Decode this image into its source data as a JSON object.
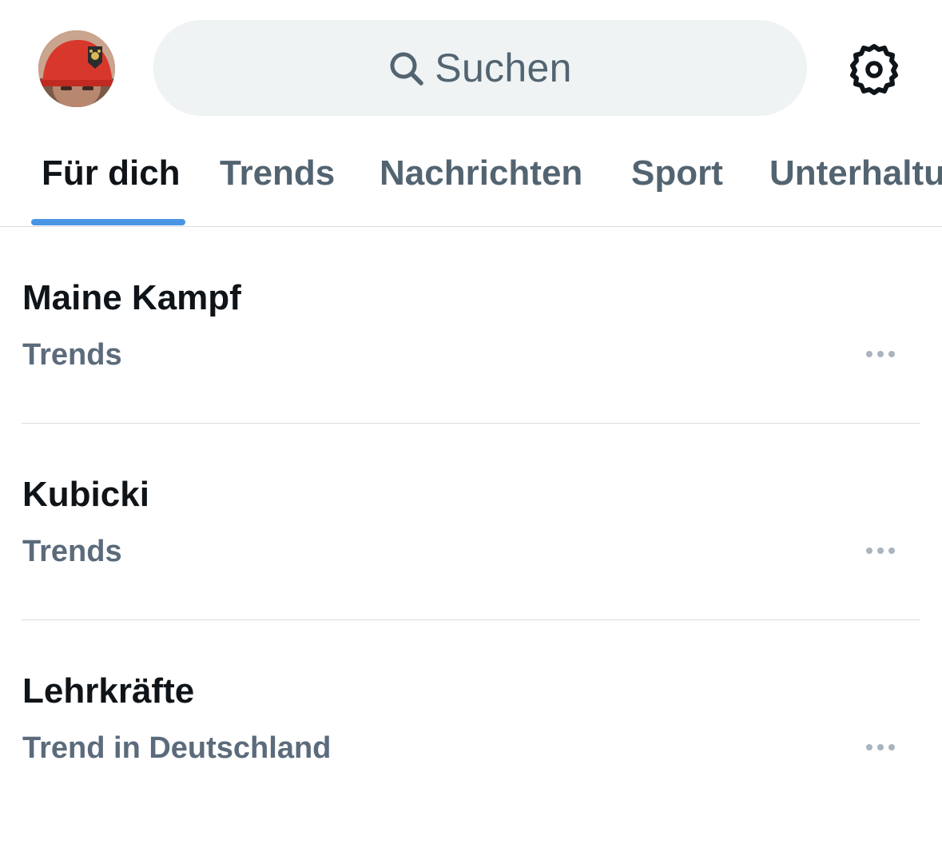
{
  "header": {
    "search": {
      "placeholder": "Suchen",
      "icon": "search-icon"
    },
    "settings_icon": "gear-icon",
    "avatar_icon": "avatar"
  },
  "tabs": [
    {
      "label": "Für dich",
      "active": true
    },
    {
      "label": "Trends",
      "active": false
    },
    {
      "label": "Nachrichten",
      "active": false
    },
    {
      "label": "Sport",
      "active": false
    },
    {
      "label": "Unterhaltung",
      "active": false
    }
  ],
  "trends": [
    {
      "title": "Maine Kampf",
      "subtitle": "Trends"
    },
    {
      "title": "Kubicki",
      "subtitle": "Trends"
    },
    {
      "title": "Lehrkräfte",
      "subtitle": "Trend in Deutschland"
    }
  ],
  "colors": {
    "accent": "#4a94e4",
    "primary_text": "#0f1419",
    "secondary_text": "#536471",
    "search_bg": "#eff3f4",
    "divider": "#d6dce0"
  }
}
